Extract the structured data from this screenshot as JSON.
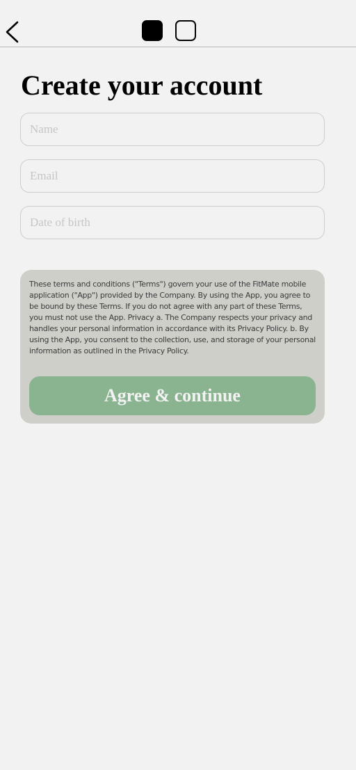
{
  "header": {
    "back_icon": "chevron-left-icon",
    "steps": [
      {
        "state": "active"
      },
      {
        "state": "inactive"
      }
    ]
  },
  "page": {
    "title": "Create your account"
  },
  "form": {
    "name_placeholder": "Name",
    "email_placeholder": "Email",
    "dob_placeholder": "Date of birth"
  },
  "terms": {
    "text": "These terms and conditions (\"Terms\") govern your use of the FitMate mobile application (\"App\") provided by the Company. By using the App, you agree to be bound by these Terms. If you do not agree with any part of these Terms, you must not use the App. Privacy a. The Company respects your privacy and handles your personal information in accordance with its Privacy Policy. b. By using the App, you consent to the collection, use, and storage of your personal information as outlined in the Privacy Policy.",
    "button_label": "Agree & continue"
  },
  "colors": {
    "background": "#f2f2f2",
    "card": "#cfcfca",
    "accent": "#8ab490",
    "field_border": "#cdcdcd"
  }
}
